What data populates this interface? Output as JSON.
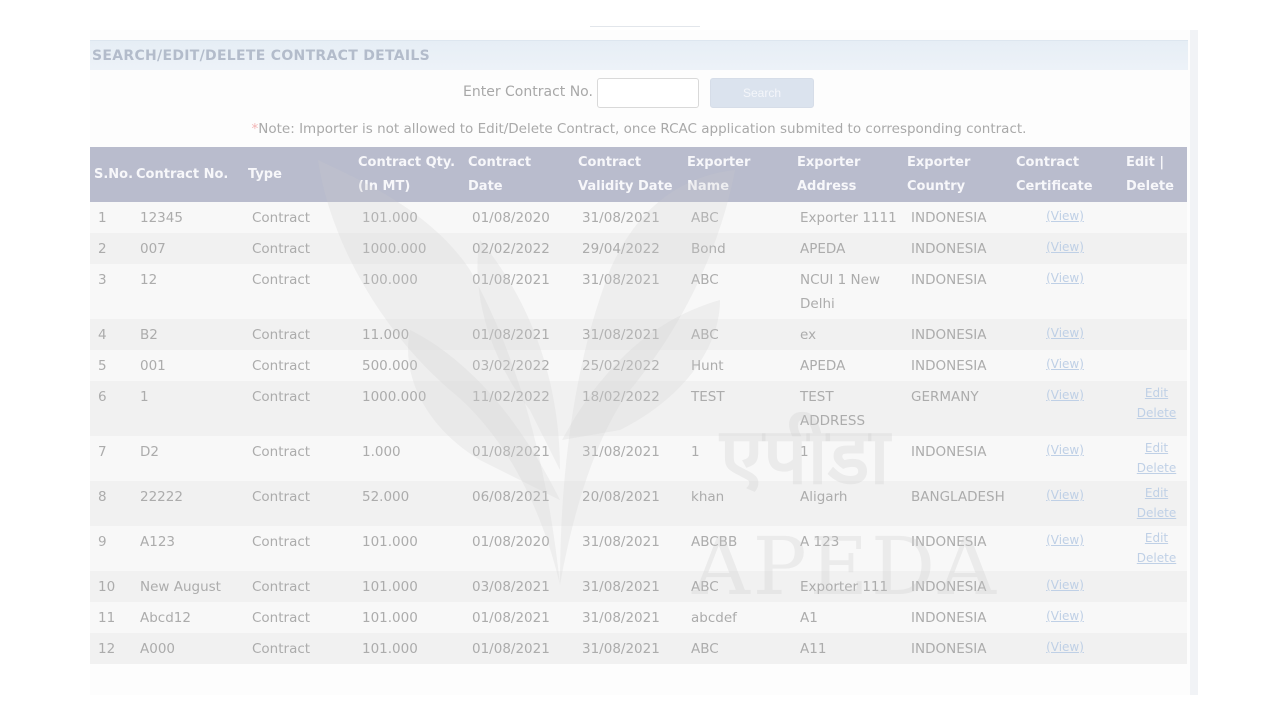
{
  "section": {
    "title": "SEARCH/EDIT/DELETE CONTRACT DETAILS"
  },
  "search": {
    "label": "Enter Contract No.",
    "value": "",
    "button": "Search"
  },
  "note": {
    "star": "*",
    "text": "Note: Importer is not allowed to Edit/Delete Contract, once RCAC application submited to corresponding contract."
  },
  "table": {
    "headers": [
      "S.No.",
      "Contract No.",
      "Type",
      "Contract Qty. (In MT)",
      "Contract Date",
      "Contract Validity Date",
      "Exporter Name",
      "Exporter Address",
      "Exporter Country",
      "Contract Certificate",
      "Edit | Delete"
    ],
    "rows": [
      {
        "sno": "1",
        "contract_no": "12345",
        "type": "Contract",
        "qty": "101.000",
        "date": "01/08/2020",
        "validity": "31/08/2021",
        "exporter": "ABC",
        "address": "Exporter 1111",
        "country": "INDONESIA",
        "certificate": "(View)",
        "edit": "",
        "delete": ""
      },
      {
        "sno": "2",
        "contract_no": "007",
        "type": "Contract",
        "qty": "1000.000",
        "date": "02/02/2022",
        "validity": "29/04/2022",
        "exporter": "Bond",
        "address": "APEDA",
        "country": "INDONESIA",
        "certificate": "(View)",
        "edit": "",
        "delete": ""
      },
      {
        "sno": "3",
        "contract_no": "12",
        "type": "Contract",
        "qty": "100.000",
        "date": "01/08/2021",
        "validity": "31/08/2021",
        "exporter": "ABC",
        "address": "NCUI 1 New Delhi",
        "country": "INDONESIA",
        "certificate": "(View)",
        "edit": "",
        "delete": ""
      },
      {
        "sno": "4",
        "contract_no": "B2",
        "type": "Contract",
        "qty": "11.000",
        "date": "01/08/2021",
        "validity": "31/08/2021",
        "exporter": "ABC",
        "address": "ex",
        "country": "INDONESIA",
        "certificate": "(View)",
        "edit": "",
        "delete": ""
      },
      {
        "sno": "5",
        "contract_no": "001",
        "type": "Contract",
        "qty": "500.000",
        "date": "03/02/2022",
        "validity": "25/02/2022",
        "exporter": "Hunt",
        "address": "APEDA",
        "country": "INDONESIA",
        "certificate": "(View)",
        "edit": "",
        "delete": ""
      },
      {
        "sno": "6",
        "contract_no": "1",
        "type": "Contract",
        "qty": "1000.000",
        "date": "11/02/2022",
        "validity": "18/02/2022",
        "exporter": "TEST",
        "address": "TEST ADDRESS",
        "country": "GERMANY",
        "certificate": "(View)",
        "edit": "Edit",
        "delete": "Delete"
      },
      {
        "sno": "7",
        "contract_no": "D2",
        "type": "Contract",
        "qty": "1.000",
        "date": "01/08/2021",
        "validity": "31/08/2021",
        "exporter": "1",
        "address": "1",
        "country": "INDONESIA",
        "certificate": "(View)",
        "edit": "Edit",
        "delete": "Delete"
      },
      {
        "sno": "8",
        "contract_no": "22222",
        "type": "Contract",
        "qty": "52.000",
        "date": "06/08/2021",
        "validity": "20/08/2021",
        "exporter": "khan",
        "address": "Aligarh",
        "country": "BANGLADESH",
        "certificate": "(View)",
        "edit": "Edit",
        "delete": "Delete"
      },
      {
        "sno": "9",
        "contract_no": "A123",
        "type": "Contract",
        "qty": "101.000",
        "date": "01/08/2020",
        "validity": "31/08/2021",
        "exporter": "ABCBB",
        "address": "A 123",
        "country": "INDONESIA",
        "certificate": "(View)",
        "edit": "Edit",
        "delete": "Delete"
      },
      {
        "sno": "10",
        "contract_no": "New August",
        "type": "Contract",
        "qty": "101.000",
        "date": "03/08/2021",
        "validity": "31/08/2021",
        "exporter": "ABC",
        "address": "Exporter 111",
        "country": "INDONESIA",
        "certificate": "(View)",
        "edit": "",
        "delete": ""
      },
      {
        "sno": "11",
        "contract_no": "Abcd12",
        "type": "Contract",
        "qty": "101.000",
        "date": "01/08/2021",
        "validity": "31/08/2021",
        "exporter": "abcdef",
        "address": "A1",
        "country": "INDONESIA",
        "certificate": "(View)",
        "edit": "",
        "delete": ""
      },
      {
        "sno": "12",
        "contract_no": "A000",
        "type": "Contract",
        "qty": "101.000",
        "date": "01/08/2021",
        "validity": "31/08/2021",
        "exporter": "ABC",
        "address": "A11",
        "country": "INDONESIA",
        "certificate": "(View)",
        "edit": "",
        "delete": ""
      }
    ]
  },
  "watermark": {
    "hindi": "एपीडा",
    "english": "APEDA",
    "logo_icon": "leaf-logo-icon"
  },
  "colors": {
    "header_bg": "#b9bccd",
    "section_bg": "#e6eef5",
    "link": "#bfd0e6"
  }
}
